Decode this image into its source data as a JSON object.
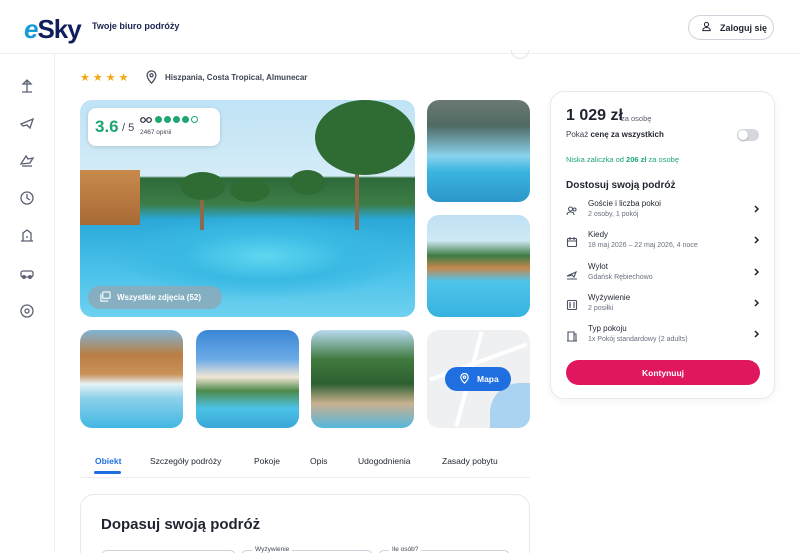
{
  "header": {
    "logo_text": "eSky",
    "tagline": "Twoje biuro podróży",
    "login_label": "Zaloguj się"
  },
  "sidebar": {
    "icons": [
      "beach-icon",
      "plane-icon",
      "plane-hotel-icon",
      "last-minute-icon",
      "hotel-icon",
      "car-icon",
      "compass-icon"
    ]
  },
  "hotel": {
    "stars": "★★★★",
    "location": "Hiszpania, Costa Tropical, Almunecar"
  },
  "rating": {
    "score": "3.6",
    "out_of": "/ 5",
    "reviews": "2467 opinii",
    "dots": [
      1,
      1,
      1,
      1,
      0.5
    ]
  },
  "gallery": {
    "all_photos_label": "Wszystkie zdjęcia (52)",
    "map_label": "Mapa"
  },
  "tabs": [
    "Obiekt",
    "Szczegóły podróży",
    "Pokoje",
    "Opis",
    "Udogodnienia",
    "Zasady pobytu"
  ],
  "form": {
    "title": "Dopasuj swoją podróż",
    "field_labels": [
      "",
      "Wyżywienie",
      "Ile osób?"
    ]
  },
  "booking": {
    "price": "1 029 zł",
    "per_person": "za osobę",
    "show_total_prefix": "Pokaż ",
    "show_total_bold": "cenę za wszystkich",
    "deposit_prefix": "Niska zaliczka od ",
    "deposit_amount": "206 zł",
    "deposit_suffix": " za osobę",
    "customize_title": "Dostosuj swoją podróż",
    "options": [
      {
        "title": "Goście i liczba pokoi",
        "sub": "2 osoby, 1 pokój",
        "icon": "guests-icon"
      },
      {
        "title": "Kiedy",
        "sub": "18 maj 2026 – 22 maj 2026, 4 noce",
        "icon": "calendar-icon"
      },
      {
        "title": "Wylot",
        "sub": "Gdańsk Rębiechowo",
        "icon": "departure-icon"
      },
      {
        "title": "Wyżywienie",
        "sub": "2 posiłki",
        "icon": "meal-icon"
      },
      {
        "title": "Typ pokoju",
        "sub": "1x Pokój standardowy (2 adults)",
        "icon": "room-icon"
      }
    ],
    "continue_label": "Kontynuuj"
  },
  "colors": {
    "brand_pink": "#e0175f",
    "accent_blue": "#1f6fe0",
    "rating_green": "#1ea672",
    "star_orange": "#f3a712"
  }
}
